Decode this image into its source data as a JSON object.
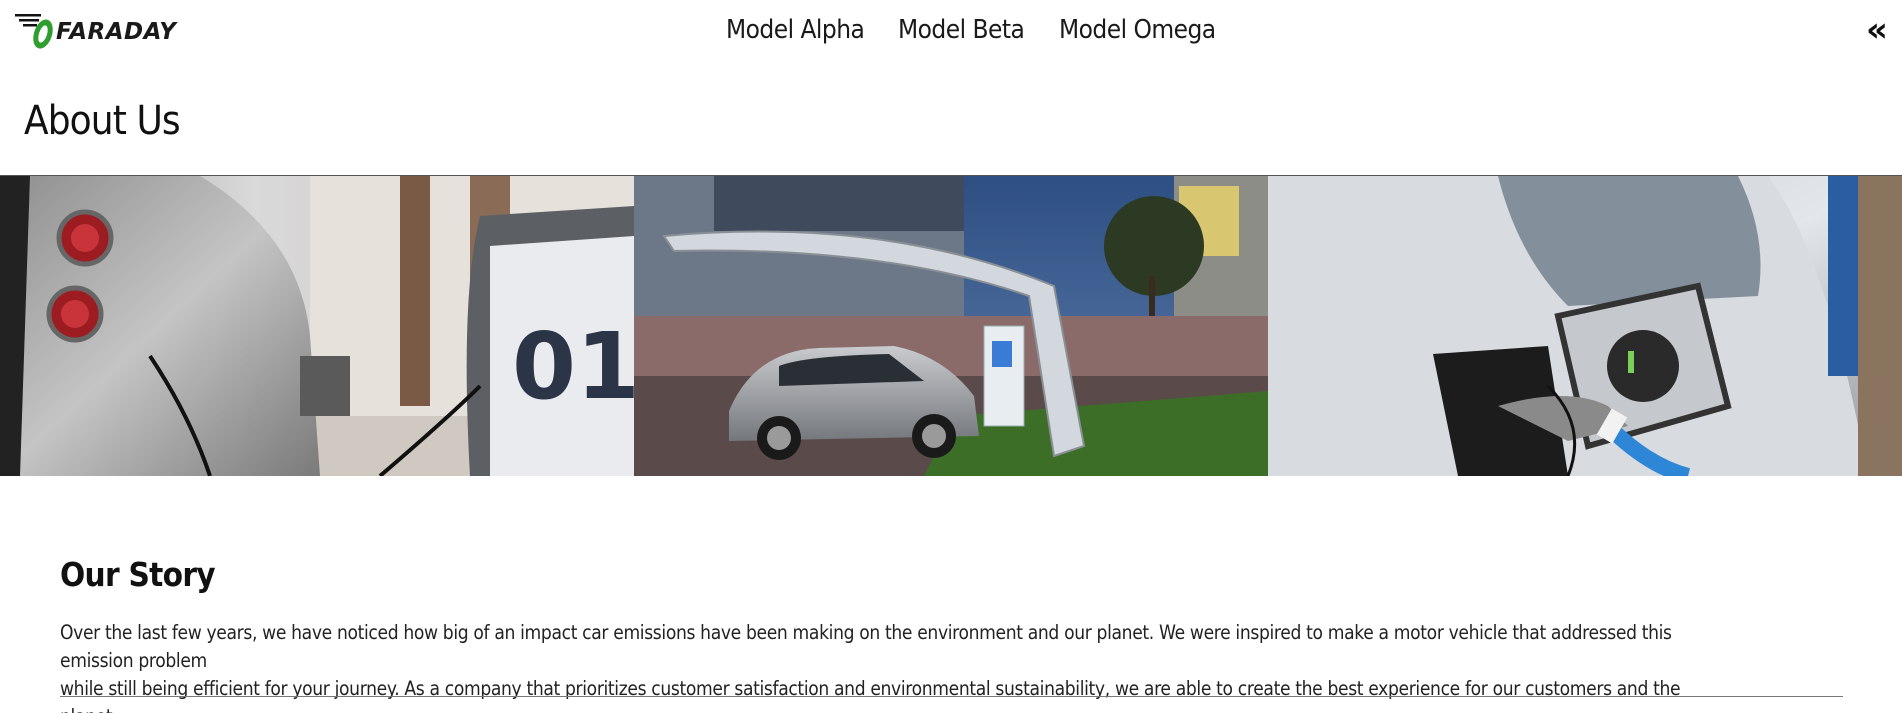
{
  "brand": {
    "name": "FARADAY",
    "accent": "#2e9e2e"
  },
  "nav": {
    "items": [
      "Model Alpha",
      "Model Beta",
      "Model Omega"
    ]
  },
  "header": {
    "collapse_glyph": "«",
    "collapse_icon": "double-chevron-left-icon"
  },
  "main": {
    "title": "About Us"
  },
  "hero": {
    "images": [
      {
        "name": "hero-image-charging-station-01"
      },
      {
        "name": "hero-image-car-under-canopy"
      },
      {
        "name": "hero-image-charging-port"
      }
    ],
    "station_number": "01"
  },
  "story": {
    "heading": "Our Story",
    "line1": "Over the last few years, we have noticed how big of an impact car emissions have been making on the environment and our planet. We were inspired to make a motor vehicle that addressed this emission problem",
    "line2": "while still being efficient for your journey. As a company that prioritizes customer satisfaction and environmental sustainability, we are able to create the best experience for our customers and the planet."
  }
}
